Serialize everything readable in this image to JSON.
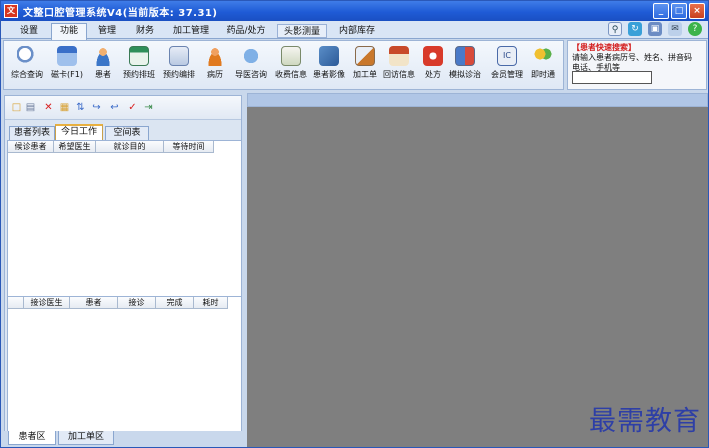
{
  "window": {
    "app_icon_text": "文",
    "title": "文整口腔管理系统V4(当前版本: 37.31)",
    "minimize": "_",
    "maximize": "□",
    "close": "×"
  },
  "menu": {
    "tabs": [
      "设置",
      "功能",
      "管理",
      "财务",
      "加工管理",
      "药品/处方",
      "头影测量",
      "内部库存"
    ],
    "active": "功能"
  },
  "ribbon": {
    "buttons": [
      "综合查询",
      "磁卡(F1)",
      "患者",
      "预约排班",
      "预约编排",
      "病历",
      "导医咨询",
      "收费信息",
      "患者影像",
      "加工单",
      "回访信息",
      "处方",
      "模拟诊治",
      "会员管理",
      "即时通"
    ]
  },
  "quick_search": {
    "title": "【患者快速搜索】",
    "hint_line1": "请输入患者病历号、姓名、拼音码",
    "hint_line2": "电话、手机等",
    "value": ""
  },
  "left_panel": {
    "tabs": [
      "患者列表",
      "今日工作",
      "空间表"
    ],
    "active_tab": "今日工作",
    "grid1_columns": [
      "候诊患者",
      "希望医生",
      "就诊目的",
      "等待时间"
    ],
    "grid2_columns": [
      "接诊医生",
      "患者",
      "接诊",
      "完成",
      "耗时"
    ],
    "bottom_tabs": [
      "患者区",
      "加工单区"
    ],
    "active_bottom_tab": "患者区"
  },
  "watermark": "最需教育",
  "colors": {
    "title_bar": "#1f5bd6",
    "workspace": "#7f7f7f",
    "quick_title": "#d42020",
    "watermark": "#2e3fa6"
  }
}
